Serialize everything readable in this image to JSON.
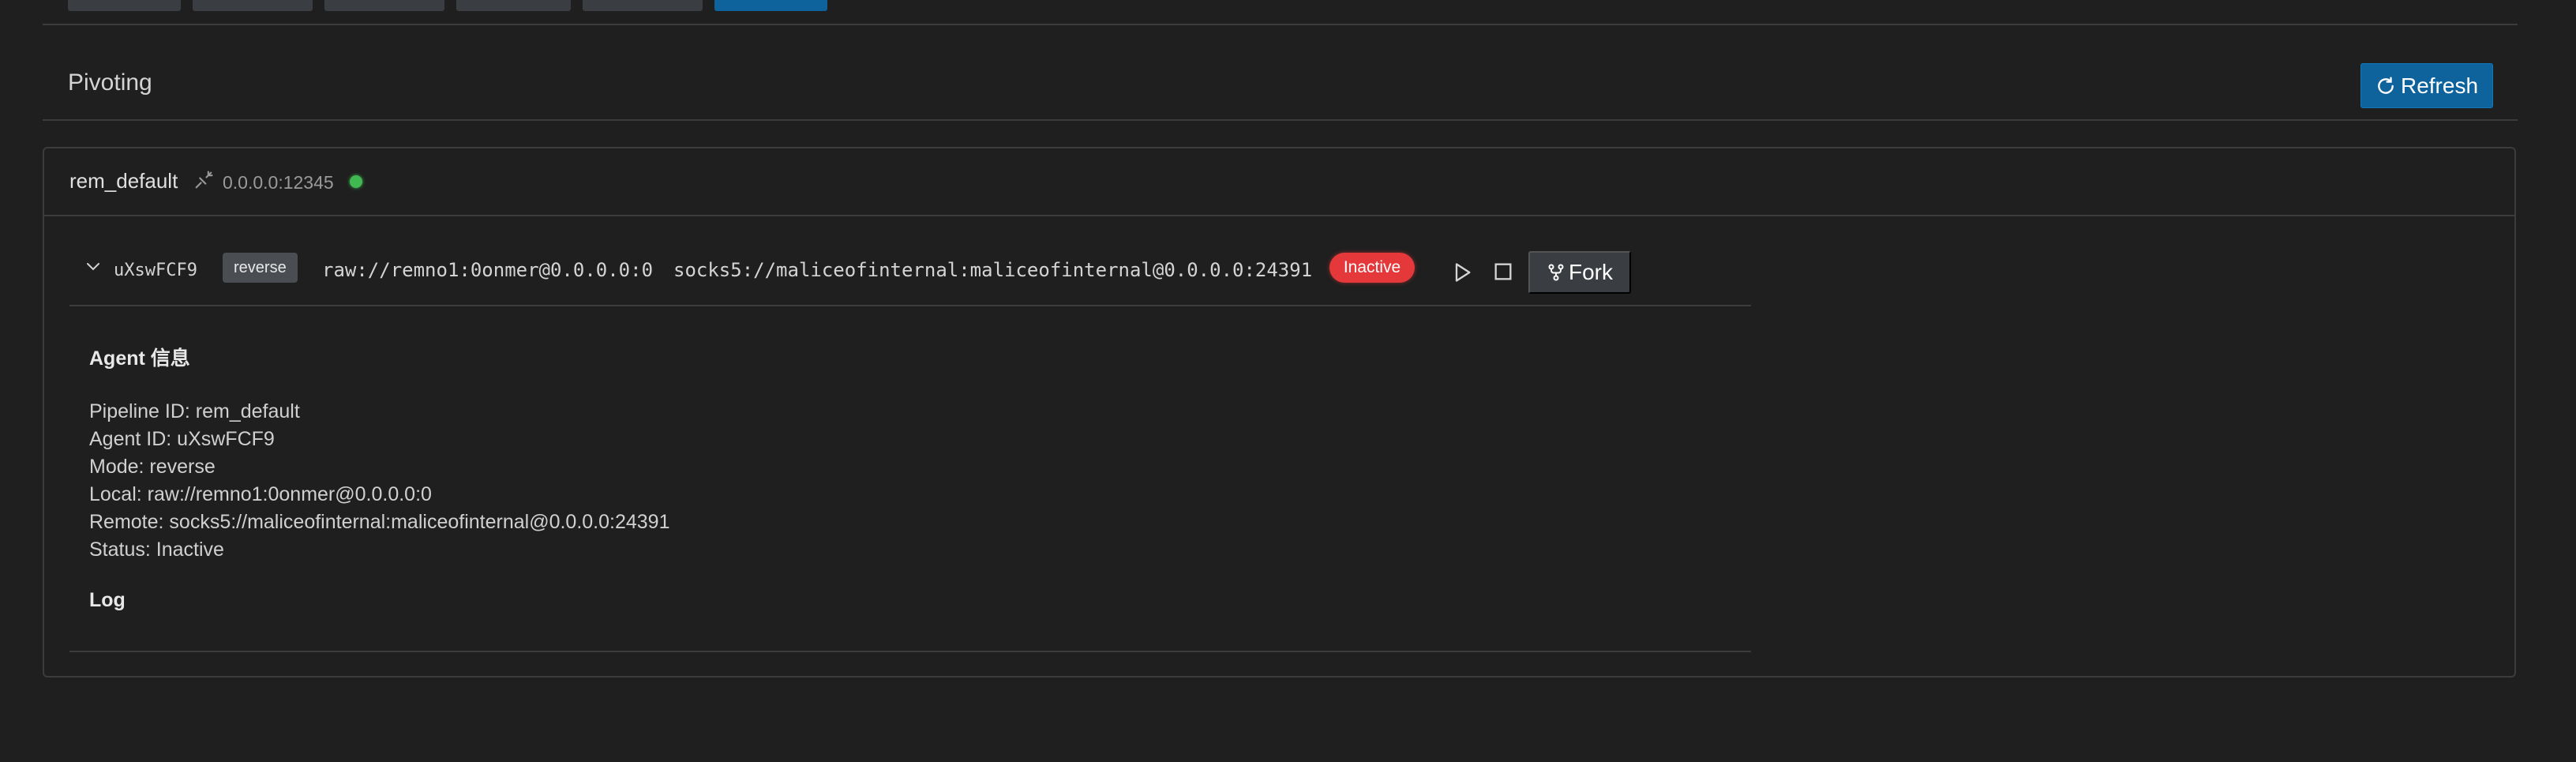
{
  "section": {
    "title": "Pivoting",
    "refresh_label": "Refresh"
  },
  "pipeline": {
    "name": "rem_default",
    "address": "0.0.0.0:12345",
    "status_color": "#3fb950"
  },
  "agent": {
    "id": "uXswFCF9",
    "mode": "reverse",
    "local": "raw://remno1:0onmer@0.0.0.0:0",
    "remote": "socks5://maliceofinternal:maliceofinternal@0.0.0.0:24391",
    "status": "Inactive",
    "status_color": "#e5383b",
    "fork_label": "Fork"
  },
  "details": {
    "heading": "Agent 信息",
    "pipeline_line": "Pipeline ID: rem_default",
    "agent_line": "Agent ID: uXswFCF9",
    "mode_line": "Mode: reverse",
    "local_line": "Local: raw://remno1:0onmer@0.0.0.0:0",
    "remote_line": "Remote: socks5://maliceofinternal:maliceofinternal@0.0.0.0:24391",
    "status_line": "Status: Inactive",
    "log_heading": "Log"
  },
  "colors": {
    "accent": "#0e639c",
    "background": "#1f1f1f",
    "border": "#3c3c3c"
  }
}
